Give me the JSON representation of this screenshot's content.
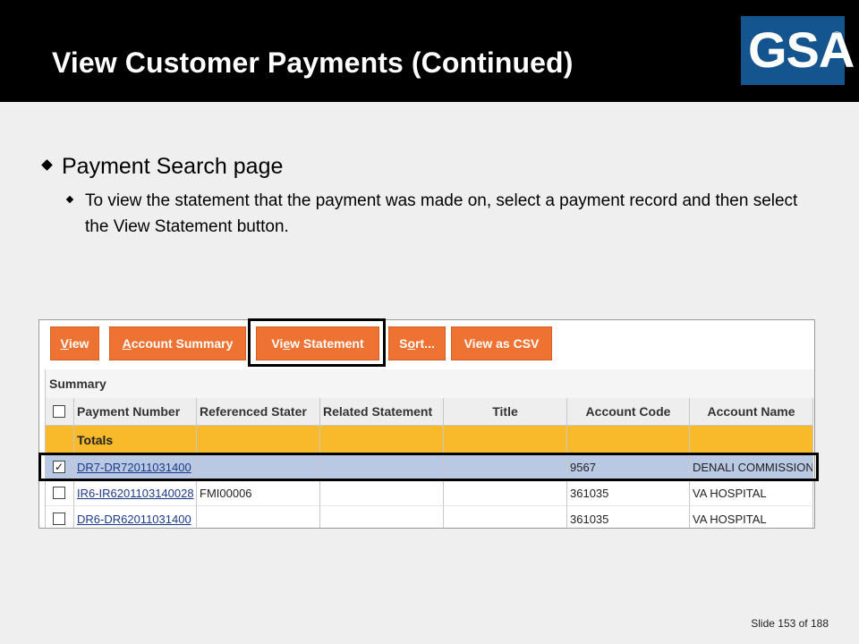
{
  "slide": {
    "title": "View Customer Payments (Continued)",
    "bullet1": "Payment Search page",
    "bullet2": "To view the statement that the payment was made on, select a payment record and then select the View Statement button.",
    "footer": "Slide 153 of 188"
  },
  "logo": {
    "text": "GSA",
    "mark": "®",
    "color": "#14548f"
  },
  "toolbar": {
    "view": {
      "first": "V",
      "rest": "iew"
    },
    "account_summary": {
      "first": "A",
      "rest": "ccount Summary"
    },
    "view_statement": {
      "pre": "Vi",
      "u": "e",
      "post": "w Statement"
    },
    "sort": {
      "pre": "S",
      "u": "o",
      "post": "rt..."
    },
    "view_csv": "View as CSV"
  },
  "grid": {
    "summary_label": "Summary",
    "headers": [
      "Payment Number",
      "Referenced Stater",
      "Related Statement",
      "Title",
      "Account Code",
      "Account Name"
    ],
    "totals_label": "Totals",
    "rows": [
      {
        "checked": "✓",
        "payment": "DR7-DR72011031400",
        "referenced": "",
        "related": "",
        "title": "",
        "account_code": "9567",
        "account_name": "DENALI COMMISSION"
      },
      {
        "checked": "",
        "payment": "IR6-IR6201103140028",
        "referenced": "FMI00006",
        "related": "",
        "title": "",
        "account_code": "361035",
        "account_name": "VA HOSPITAL"
      },
      {
        "checked": "",
        "payment": "DR6-DR62011031400",
        "referenced": "",
        "related": "",
        "title": "",
        "account_code": "361035",
        "account_name": "VA HOSPITAL"
      }
    ]
  },
  "colors": {
    "button": "#ee7333",
    "totals": "#f8ba2a",
    "selected_row": "#b9c9e3"
  }
}
